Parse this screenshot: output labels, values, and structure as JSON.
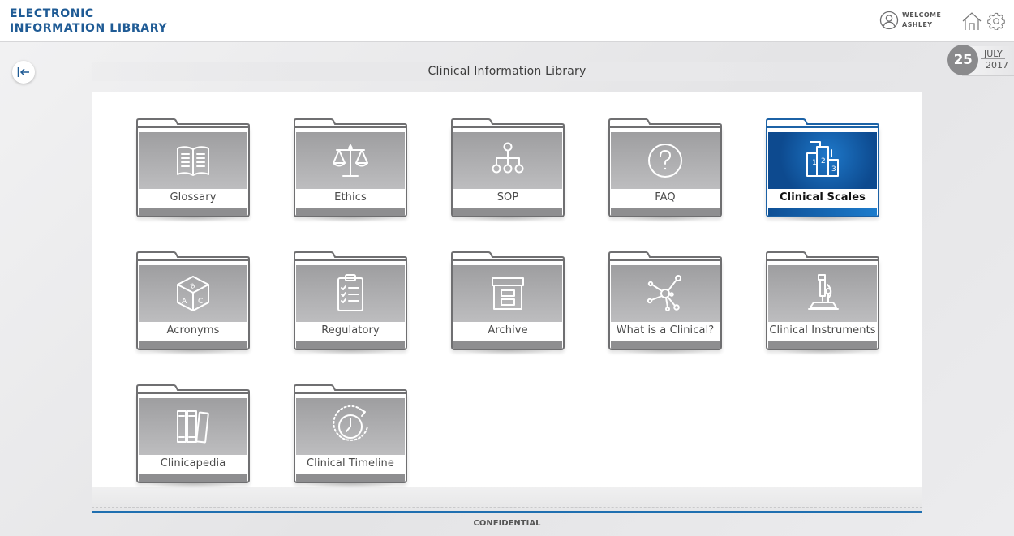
{
  "header": {
    "brand_line1": "ELECTRONIC",
    "brand_line2": "INFORMATION LIBRARY",
    "welcome_line1": "WELCOME",
    "welcome_line2": "ASHLEY",
    "icons": [
      "user-icon",
      "home-icon",
      "gear-icon"
    ]
  },
  "date": {
    "day": "25",
    "month": "JULY",
    "year": "2017"
  },
  "page": {
    "title": "Clinical Information Library"
  },
  "tiles": [
    {
      "label": "Glossary",
      "icon": "book-icon",
      "active": false
    },
    {
      "label": "Ethics",
      "icon": "scales-icon",
      "active": false
    },
    {
      "label": "SOP",
      "icon": "hierarchy-icon",
      "active": false
    },
    {
      "label": "FAQ",
      "icon": "question-icon",
      "active": false
    },
    {
      "label": "Clinical Scales",
      "icon": "podium-icon",
      "active": true
    },
    {
      "label": "Acronyms",
      "icon": "letter-cube-icon",
      "active": false
    },
    {
      "label": "Regulatory",
      "icon": "clipboard-checklist-icon",
      "active": false
    },
    {
      "label": "Archive",
      "icon": "archive-box-icon",
      "active": false
    },
    {
      "label": "What is a Clinical?",
      "icon": "molecule-icon",
      "active": false
    },
    {
      "label": "Clinical Instruments",
      "icon": "microscope-icon",
      "active": false
    },
    {
      "label": "Clinicapedia",
      "icon": "books-icon",
      "active": false
    },
    {
      "label": "Clinical Timeline",
      "icon": "clock-history-icon",
      "active": false
    }
  ],
  "footer": {
    "text": "CONFIDENTIAL"
  },
  "colors": {
    "brand": "#1f5b95",
    "active_tile": "#1c62a6",
    "footer_rule": "#1f6fb0",
    "tile_art": "#a8a8aa"
  }
}
